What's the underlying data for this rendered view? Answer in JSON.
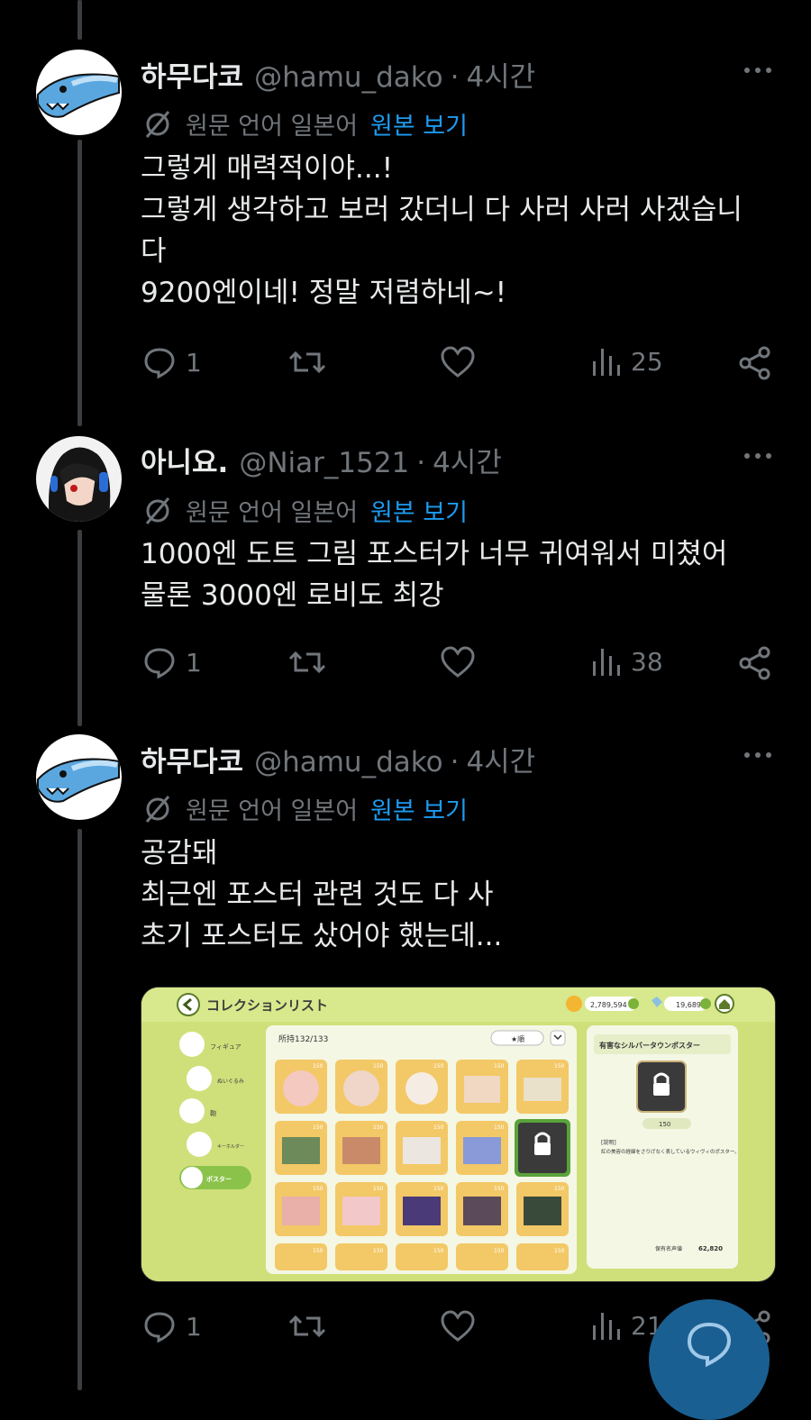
{
  "colors": {
    "accent": "#1d9bf0",
    "muted": "#71767b",
    "text": "#e7e9ea",
    "background": "#000000"
  },
  "tweets": [
    {
      "name": "하무다코",
      "handle": "@hamu_dako",
      "dot": "·",
      "time": "4시간",
      "translate": {
        "icon": "translate-off-icon",
        "lang": "원문 언어 일본어",
        "link": "원본 보기"
      },
      "lines": [
        "그렇게 매력적이야...!",
        "그렇게 생각하고 보러 갔더니 다 사러 사러 사겠습니",
        "다",
        "9200엔이네! 정말 저렴하네~!"
      ],
      "replies": "1",
      "views": "25"
    },
    {
      "name": "아니요.",
      "handle": "@Niar_1521",
      "dot": "·",
      "time": "4시간",
      "translate": {
        "icon": "translate-off-icon",
        "lang": "원문 언어 일본어",
        "link": "원본 보기"
      },
      "lines": [
        "1000엔 도트 그림 포스터가 너무 귀여워서 미쳤어",
        "물론 3000엔 로비도 최강"
      ],
      "replies": "1",
      "views": "38"
    },
    {
      "name": "하무다코",
      "handle": "@hamu_dako",
      "dot": "·",
      "time": "4시간",
      "translate": {
        "icon": "translate-off-icon",
        "lang": "원문 언어 일본어",
        "link": "원본 보기"
      },
      "lines": [
        "공감돼",
        "최근엔 포스터 관련 것도 다 사",
        "초기 포스터도 샀어야 했는데..."
      ],
      "replies": "1",
      "views": "21"
    }
  ],
  "game": {
    "title": "コレクションリスト",
    "currency1": "2,789,594",
    "currency2": "19,689",
    "owned": "所持132/133",
    "sort": "★順",
    "categories": [
      "フィギュア",
      "ぬいぐるみ",
      "鞄",
      "キーホルダー",
      "ポスター"
    ],
    "item_price": "150",
    "detail": {
      "title": "有害なシルバータウンポスター",
      "price": "150",
      "desc_tag": "[説明]",
      "desc": "紅の美容の経緯をさりげなく表しているウィヴィのポスター。",
      "fame_label": "保有名声値",
      "fame": "62,820"
    }
  }
}
